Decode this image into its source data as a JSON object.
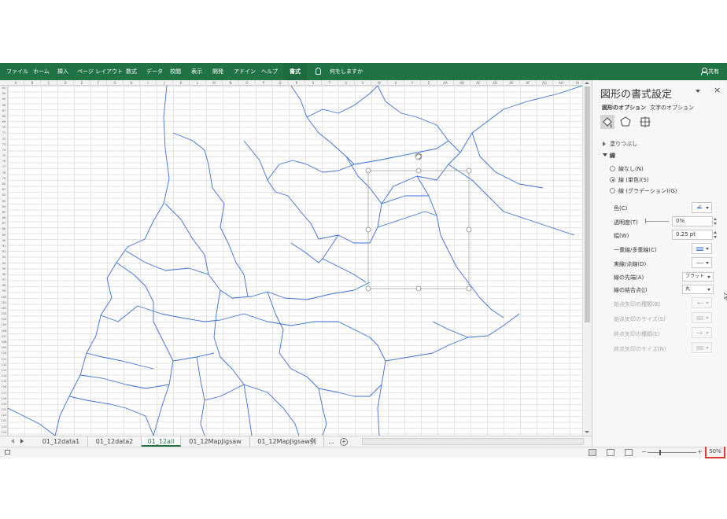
{
  "ribbon": {
    "tabs": [
      {
        "label": "ファイル"
      },
      {
        "label": "ホーム"
      },
      {
        "label": "挿入"
      },
      {
        "label": "ページ レイアウト"
      },
      {
        "label": "数式"
      },
      {
        "label": "データ"
      },
      {
        "label": "校閲"
      },
      {
        "label": "表示"
      },
      {
        "label": "開発"
      },
      {
        "label": "アドイン"
      },
      {
        "label": "ヘルプ"
      },
      {
        "label": "書式"
      }
    ],
    "active_tab": "書式",
    "tell_me": "何をしますか",
    "share": "共有",
    "accent_color": "#217346"
  },
  "sheet": {
    "columns": [
      "A",
      "B",
      "C",
      "D",
      "E",
      "F",
      "G",
      "H",
      "I",
      "J",
      "K",
      "L",
      "M",
      "N",
      "O",
      "P",
      "Q",
      "R",
      "S",
      "T",
      "U",
      "V",
      "W",
      "X",
      "Y",
      "Z",
      "AA",
      "AB",
      "AC",
      "AD",
      "AE",
      "AF",
      "AG",
      "AH",
      "AI"
    ],
    "rows": [
      "63",
      "64",
      "65",
      "66",
      "67",
      "68",
      "69",
      "70",
      "71",
      "72",
      "73",
      "74",
      "75",
      "76",
      "77",
      "78",
      "79",
      "80",
      "81",
      "82",
      "83",
      "84",
      "85",
      "86",
      "87",
      "88",
      "89",
      "90",
      "91",
      "92",
      "93",
      "94",
      "95",
      "96",
      "97",
      "98",
      "99",
      "100",
      "101",
      "102",
      "103",
      "104",
      "105",
      "106",
      "107",
      "108",
      "109",
      "110",
      "111",
      "112",
      "113",
      "114",
      "115",
      "116",
      "117",
      "118",
      "119",
      "120",
      "121",
      "122",
      "123",
      "124"
    ],
    "map_line_color": "#3b6fd4"
  },
  "sheet_tabs": {
    "tabs": [
      {
        "label": "01_12data1"
      },
      {
        "label": "01_12data2"
      },
      {
        "label": "01_12all"
      },
      {
        "label": "01_12MapJigsaw"
      },
      {
        "label": "01_12MapJigsaw例"
      }
    ],
    "active": "01_12all",
    "more": "...",
    "add": "+"
  },
  "status": {
    "zoom": "50%",
    "zoom_minus": "−",
    "zoom_plus": "+",
    "highlight_color": "#e53935"
  },
  "format_pane": {
    "title": "図形の書式設定",
    "close": "×",
    "tabs": [
      {
        "label": "図形のオプション"
      },
      {
        "label": "文字のオプション"
      }
    ],
    "active_tab": "図形のオプション",
    "icons": [
      "fill-line-icon",
      "effects-icon",
      "size-properties-icon"
    ],
    "sections": {
      "fill": "塗りつぶし",
      "line": "線"
    },
    "line_options": [
      {
        "label": "線なし(N)",
        "checked": false
      },
      {
        "label": "線 (単色)(S)",
        "checked": true
      },
      {
        "label": "線 (グラデーション)(G)",
        "checked": false
      }
    ],
    "properties": {
      "color": "色(C)",
      "transparency": "透明度(T)",
      "transparency_value": "0%",
      "width": "幅(W)",
      "width_value": "0.25 pt",
      "compound": "一重線/多重線(C)",
      "dash": "実線/点線(D)",
      "cap": "線の先端(A)",
      "cap_value": "フラット",
      "join": "線の結合点(J)",
      "join_value": "丸",
      "begin_arrow_type": "始点矢印の種類(B)",
      "begin_arrow_size": "始点矢印のサイズ(S)",
      "end_arrow_type": "終点矢印の種類(E)",
      "end_arrow_size": "終点矢印のサイズ(N)"
    },
    "line_color": "#2e6fd6"
  }
}
